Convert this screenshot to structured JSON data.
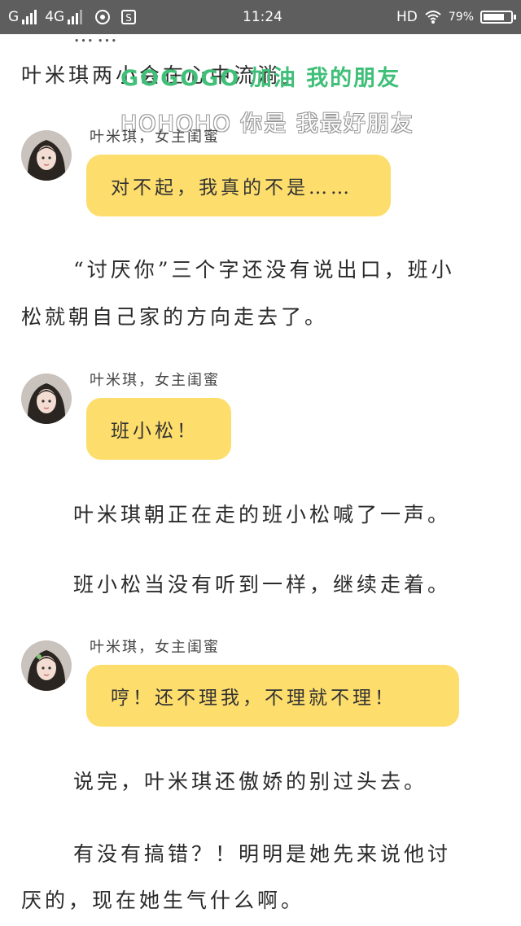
{
  "status_bar": {
    "carrier1": "G",
    "carrier2": "4G",
    "time": "11:24",
    "hd": "HD",
    "battery_percent_text": "79%",
    "battery_level": 0.79
  },
  "watermark": {
    "line1": "GOGOGO 加油 我的朋友",
    "line2": "HOHOHO 你是 我最好朋友"
  },
  "content": {
    "partial_top": "……",
    "line_top": "叶米琪两小会在心中流淌。",
    "avatar_icon": "girl-avatar",
    "bubble_color": "#fddd6c",
    "messages": [
      {
        "speaker": "叶米琪，女主闺蜜",
        "text": "对不起，我真的不是……"
      },
      {
        "speaker": "叶米琪，女主闺蜜",
        "text": "班小松！"
      },
      {
        "speaker": "叶米琪，女主闺蜜",
        "text": "哼！还不理我，不理就不理！"
      }
    ],
    "para1_line1": "“讨厌你”三个字还没有说出口，班小",
    "para1_line2": "松就朝自己家的方向走去了。",
    "para2": "叶米琪朝正在走的班小松喊了一声。",
    "para3": "班小松当没有听到一样，继续走着。",
    "para4": "说完，叶米琪还傲娇的别过头去。",
    "para5_line1": "有没有搞错？！明明是她先来说他讨",
    "para5_line2": "厌的，现在她生气什么啊。"
  }
}
